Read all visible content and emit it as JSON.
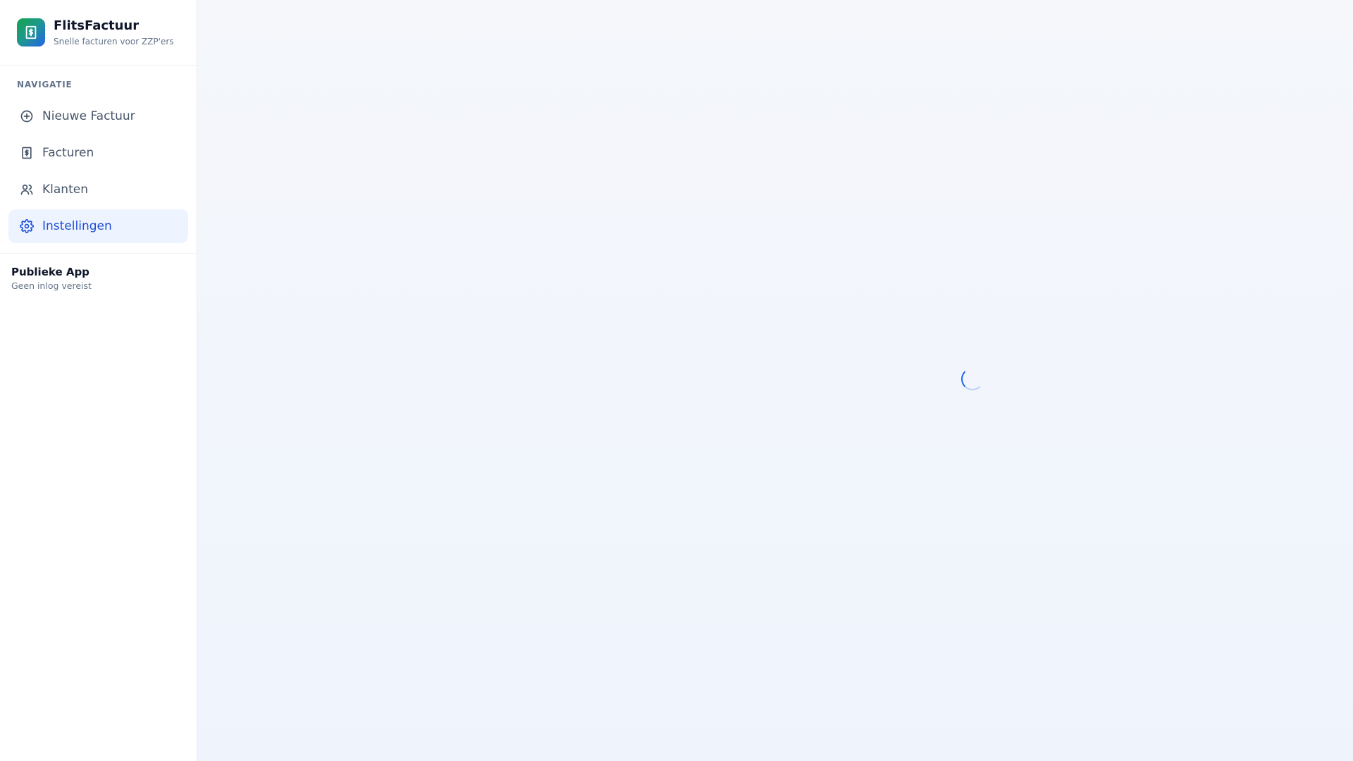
{
  "brand": {
    "title": "FlitsFactuur",
    "subtitle": "Snelle facturen voor ZZP'ers",
    "logo_icon": "receipt-dollar-icon"
  },
  "nav": {
    "heading": "NAVIGATIE",
    "items": [
      {
        "label": "Nieuwe Factuur",
        "icon": "plus-circle-icon",
        "active": false
      },
      {
        "label": "Facturen",
        "icon": "receipt-dollar-icon",
        "active": false
      },
      {
        "label": "Klanten",
        "icon": "users-icon",
        "active": false
      },
      {
        "label": "Instellingen",
        "icon": "gear-icon",
        "active": true
      }
    ]
  },
  "footer": {
    "title": "Publieke App",
    "subtitle": "Geen inlog vereist"
  },
  "main": {
    "state": "loading",
    "spinner_icon": "loading-spinner-icon"
  },
  "colors": {
    "accent": "#2563eb",
    "active_bg": "#eef4ff",
    "text_muted": "#64748b",
    "logo_gradient_start": "#16a34a",
    "logo_gradient_end": "#2563eb"
  }
}
